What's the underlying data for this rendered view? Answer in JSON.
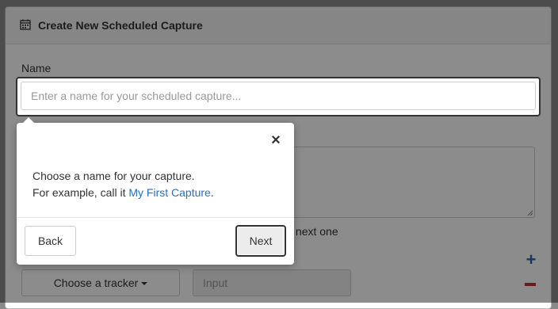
{
  "panel": {
    "title": "Create New Scheduled Capture",
    "title_icon": "calendar-icon"
  },
  "form": {
    "name_label": "Name",
    "name_placeholder": "Enter a name for your scheduled capture...",
    "partial_checkbox_text": "ing the next one",
    "tracker_button_label": "Choose a tracker",
    "value_input_placeholder": "Input",
    "add_icon": "plus-icon",
    "remove_icon": "minus-icon"
  },
  "tour": {
    "close_label": "×",
    "line1": "Choose a name for your capture.",
    "line2_prefix": "For example, call it ",
    "line2_link": "My First Capture",
    "line2_suffix": ".",
    "back_label": "Back",
    "next_label": "Next"
  },
  "colors": {
    "link": "#2a6fbf",
    "add": "#2c64b5",
    "remove": "#c9302c"
  }
}
